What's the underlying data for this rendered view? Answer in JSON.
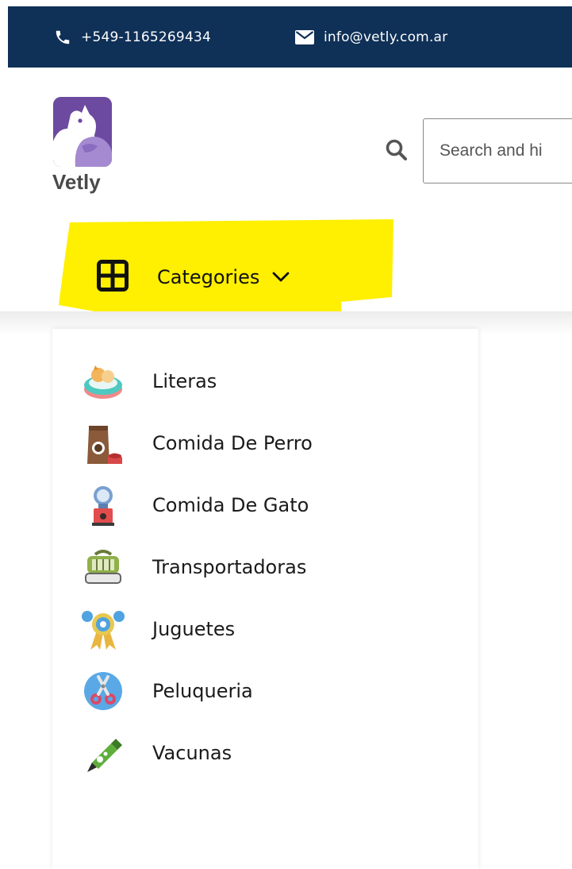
{
  "topbar": {
    "phone": "+549-1165269434",
    "email": "info@vetly.com.ar",
    "background": "#0f3057",
    "icons": [
      "phone-icon",
      "envelope-icon"
    ]
  },
  "header": {
    "brand": "Vetly",
    "search": {
      "placeholder": "Search and hi",
      "value": "",
      "icon": "search-icon"
    },
    "accent_color": "#6c4aa0"
  },
  "categories": {
    "label": "Categories",
    "highlight_color": "#ffef00",
    "icons": [
      "grid-icon",
      "chevron-down-icon"
    ],
    "items": [
      {
        "label": "Literas",
        "icon": "litter-bed-icon"
      },
      {
        "label": "Comida De Perro",
        "icon": "dog-food-bag-icon"
      },
      {
        "label": "Comida De Gato",
        "icon": "cat-food-dispenser-icon"
      },
      {
        "label": "Transportadoras",
        "icon": "pet-carrier-icon"
      },
      {
        "label": "Juguetes",
        "icon": "toy-bone-icon"
      },
      {
        "label": "Peluqueria",
        "icon": "grooming-scissors-icon"
      },
      {
        "label": "Vacunas",
        "icon": "vaccine-syringe-icon"
      }
    ]
  }
}
